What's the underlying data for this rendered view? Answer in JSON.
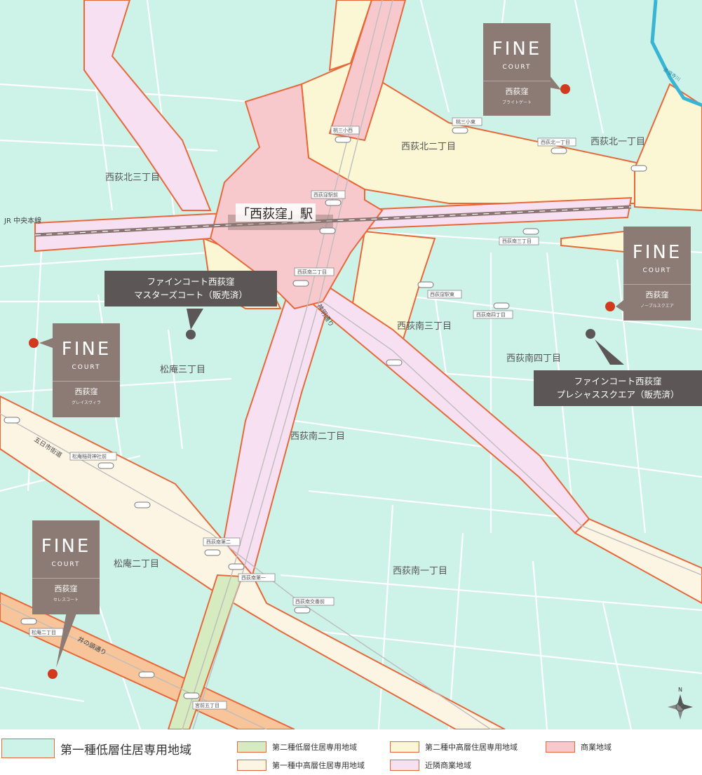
{
  "station": {
    "label": "「西荻窪」駅"
  },
  "rail": {
    "label": "JR 中央本線"
  },
  "districts": [
    {
      "label": "西荻北三丁目"
    },
    {
      "label": "西荻北二丁目"
    },
    {
      "label": "西荻北一丁目"
    },
    {
      "label": "西荻南三丁目"
    },
    {
      "label": "西荻南四丁目"
    },
    {
      "label": "松庵三丁目"
    },
    {
      "label": "西荻南二丁目"
    },
    {
      "label": "松庵二丁目"
    },
    {
      "label": "西荻南一丁目"
    }
  ],
  "roads": [
    {
      "label": "神明通り"
    },
    {
      "label": "五日市街道"
    },
    {
      "label": "井の頭通り"
    }
  ],
  "river": {
    "label": "善福寺川"
  },
  "stops": [
    {
      "label": "桃三小西"
    },
    {
      "label": "桃三小東"
    },
    {
      "label": "西荻北一丁目"
    },
    {
      "label": "西荻窪駅前"
    },
    {
      "label": "西荻南三丁目"
    },
    {
      "label": "西荻南二丁目"
    },
    {
      "label": "西荻窪駅東"
    },
    {
      "label": "西荻南四丁目"
    },
    {
      "label": "松庵稲荷神社前"
    },
    {
      "label": "西荻南第二"
    },
    {
      "label": "西荻南第一"
    },
    {
      "label": "西荻南交番前"
    },
    {
      "label": "松庵二丁目"
    },
    {
      "label": "宮前五丁目"
    }
  ],
  "properties": [
    {
      "fine": "FINE",
      "court": "COURT",
      "name": "西荻窪",
      "sub": "ブライトゲート"
    },
    {
      "fine": "FINE",
      "court": "COURT",
      "name": "西荻窪",
      "sub": "ノーブルスクエア"
    },
    {
      "fine": "FINE",
      "court": "COURT",
      "name": "西荻窪",
      "sub": "グレイスヴィラ"
    },
    {
      "fine": "FINE",
      "court": "COURT",
      "name": "西荻窪",
      "sub": "セレスコート"
    }
  ],
  "sold": [
    {
      "line1": "ファインコート西荻窪",
      "line2": "マスターズコート（販売済）"
    },
    {
      "line1": "ファインコート西荻窪",
      "line2": "プレシャススクエア（販売済）"
    }
  ],
  "compass": {
    "label": "N"
  },
  "legend": [
    {
      "label": "第一種低層住居専用地域",
      "color": "#cdf2e8"
    },
    {
      "label": "第二種低層住居専用地域",
      "color": "#d6ebbf"
    },
    {
      "label": "第二種中高層住居専用地域",
      "color": "#fbf7d4"
    },
    {
      "label": "商業地域",
      "color": "#f7c9cd"
    },
    {
      "label": "第一種中高層住居専用地域",
      "color": "#fdf5e4"
    },
    {
      "label": "近隣商業地域",
      "color": "#f7e0f2"
    }
  ],
  "colors": {
    "residential_low1": "#cdf2e8",
    "residential_low2": "#d6ebbf",
    "residential_mid2": "#fbf7d4",
    "commercial": "#f7c9cd",
    "residential_mid1": "#fdf5e4",
    "neighborhood_commercial": "#f7e0f2",
    "road_zone": "#f8c499",
    "zone_border": "#e8683a",
    "property_card": "#8c7b74",
    "callout": "#5c5656",
    "marker": "#d23a1e",
    "river": "#39b4d4"
  }
}
